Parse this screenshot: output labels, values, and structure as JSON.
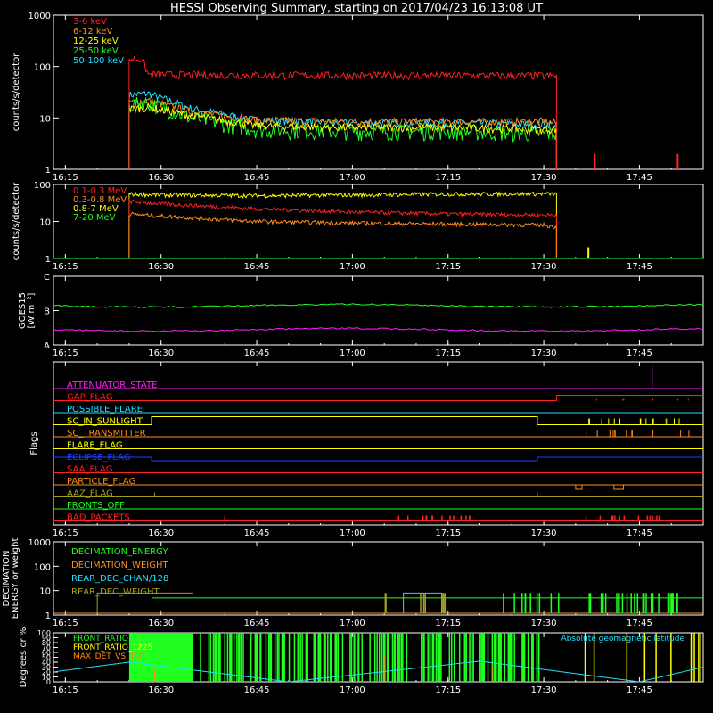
{
  "title": "HESSI Observing Summary, starting on 2017/04/23 16:13:08 UT",
  "time_axis": {
    "start": "16:13:08",
    "end": "17:55",
    "ticks": [
      "16:15",
      "16:30",
      "16:45",
      "17:00",
      "17:15",
      "17:30",
      "17:45"
    ]
  },
  "colors": {
    "red": "#ff2020",
    "orange": "#ff8c1a",
    "yellow": "#ffff00",
    "green": "#20ff20",
    "cyan": "#20e0ff",
    "magenta": "#ff20ff",
    "blue": "#2040ff",
    "olive": "#a0a020",
    "white": "#ffffff"
  },
  "chart_data": [
    {
      "type": "line",
      "ylabel": "counts/s/detector",
      "yscale": "log",
      "ylim": [
        1,
        1000
      ],
      "yticks": [
        "1",
        "10",
        "100",
        "1000"
      ],
      "legend_placement": "top-left",
      "series": [
        {
          "name": "3-6 keV",
          "color": "#ff2020",
          "x": [
            "16:25",
            "16:27",
            "16:28",
            "16:45",
            "17:00",
            "17:15",
            "17:30",
            "17:32"
          ],
          "values": [
            140,
            140,
            70,
            68,
            67,
            67,
            66,
            66
          ]
        },
        {
          "name": "6-12 keV",
          "color": "#ff8c1a",
          "x": [
            "16:25",
            "16:28",
            "16:35",
            "16:45",
            "17:00",
            "17:15",
            "17:30",
            "17:32"
          ],
          "values": [
            20,
            22,
            13,
            9,
            8.5,
            8.5,
            8.5,
            8
          ]
        },
        {
          "name": "12-25 keV",
          "color": "#ffff00",
          "x": [
            "16:25",
            "16:28",
            "16:35",
            "16:45",
            "17:00",
            "17:15",
            "17:30",
            "17:32"
          ],
          "values": [
            15,
            16,
            11,
            7,
            6.5,
            6.5,
            6,
            6
          ]
        },
        {
          "name": "25-50 keV",
          "color": "#20ff20",
          "x": [
            "16:25",
            "16:28",
            "16:35",
            "16:45",
            "17:00",
            "17:15",
            "17:30",
            "17:32"
          ],
          "values": [
            18,
            20,
            10,
            6,
            5.5,
            5.5,
            5,
            5
          ]
        },
        {
          "name": "50-100 keV",
          "color": "#20e0ff",
          "x": [
            "16:25",
            "16:28",
            "16:35",
            "16:45",
            "17:00",
            "17:15",
            "17:30",
            "17:32"
          ],
          "values": [
            28,
            30,
            15,
            9,
            8,
            8,
            7.5,
            7.5
          ]
        }
      ]
    },
    {
      "type": "line",
      "ylabel": "counts/s/detector",
      "yscale": "log",
      "ylim": [
        1,
        100
      ],
      "yticks": [
        "1",
        "10",
        "100"
      ],
      "legend_placement": "top-left",
      "series": [
        {
          "name": "0.1-0.3 MeV",
          "color": "#ff2020",
          "x": [
            "16:25",
            "16:30",
            "16:45",
            "17:00",
            "17:15",
            "17:30",
            "17:32"
          ],
          "values": [
            35,
            30,
            22,
            18,
            16,
            15,
            15
          ]
        },
        {
          "name": "0.3-0.8 MeV",
          "color": "#ff8c1a",
          "x": [
            "16:25",
            "16:30",
            "16:45",
            "17:00",
            "17:15",
            "17:30",
            "17:32"
          ],
          "values": [
            16,
            14,
            10,
            9,
            8.5,
            8,
            7
          ]
        },
        {
          "name": "0.8-7 MeV",
          "color": "#ffff00",
          "x": [
            "16:25",
            "16:30",
            "16:45",
            "17:00",
            "17:15",
            "17:30",
            "17:32"
          ],
          "values": [
            55,
            52,
            50,
            52,
            55,
            56,
            55
          ]
        },
        {
          "name": "7-20 MeV",
          "color": "#20ff20",
          "x": [
            "16:13",
            "17:55"
          ],
          "values": [
            1,
            1
          ]
        }
      ]
    },
    {
      "type": "line",
      "ylabel": "GOES15 [W m⁻²]",
      "ylabels": [
        "GOES15",
        "[W m⁻²]"
      ],
      "yticks": [
        "A",
        "B",
        "C"
      ],
      "series": [
        {
          "color": "#20ff20",
          "x": [
            "16:13",
            "17:55"
          ],
          "values": [
            "B+",
            "B+"
          ]
        },
        {
          "color": "#ff20ff",
          "x": [
            "16:13",
            "17:55"
          ],
          "values": [
            "A+",
            "A+"
          ]
        }
      ]
    },
    {
      "type": "line",
      "ylabel": "Flags",
      "flags": [
        {
          "name": "ATTENUATOR_STATE",
          "color": "#ff20ff"
        },
        {
          "name": "GAP_FLAG",
          "color": "#ff2020"
        },
        {
          "name": "POSSIBLE_FLARE",
          "color": "#20e0ff"
        },
        {
          "name": "SC_IN_SUNLIGHT",
          "color": "#ffff00"
        },
        {
          "name": "SC_TRANSMITTER",
          "color": "#ff8c1a"
        },
        {
          "name": "FLARE_FLAG",
          "color": "#ffff00"
        },
        {
          "name": "ECLIPSE_FLAG",
          "color": "#2040ff"
        },
        {
          "name": "SAA_FLAG",
          "color": "#ff2020"
        },
        {
          "name": "PARTICLE_FLAG",
          "color": "#ff8c1a"
        },
        {
          "name": "AAZ_FLAG",
          "color": "#a0a020"
        },
        {
          "name": "FRONTS_OFF",
          "color": "#20ff20"
        },
        {
          "name": "BAD_PACKETS",
          "color": "#ff2020"
        }
      ]
    },
    {
      "type": "line",
      "ylabel": "DECIMATION ENERGY or weight",
      "ylabels": [
        "DECIMATION",
        "ENERGY or weight"
      ],
      "yscale": "log",
      "ylim": [
        1,
        1000
      ],
      "yticks": [
        "1",
        "10",
        "100",
        "1000"
      ],
      "legend_placement": "top-left",
      "series": [
        {
          "name": "DECIMATION_ENERGY",
          "color": "#20ff20"
        },
        {
          "name": "DECIMATION_WEIGHT",
          "color": "#ff8c1a"
        },
        {
          "name": "REAR_DEC_CHAN/128",
          "color": "#20e0ff"
        },
        {
          "name": "REAR_DEC_WEIGHT",
          "color": "#a0a020"
        }
      ]
    },
    {
      "type": "line",
      "ylabel": "Degrees or %",
      "ylim": [
        0,
        100
      ],
      "yticks": [
        "0",
        "10",
        "20",
        "30",
        "40",
        "50",
        "60",
        "70",
        "80",
        "90",
        "100"
      ],
      "legend_placement": "top-left",
      "series": [
        {
          "name": "FRONT_RATIO",
          "color": "#20ff20"
        },
        {
          "name": "FRONT_RATIO_1225",
          "color": "#ffff00"
        },
        {
          "name": "MAX_DET_VS_TOT",
          "color": "#ff8c1a"
        },
        {
          "name": "Absolute geomagnetic latitude",
          "color": "#20e0ff",
          "x": [
            "16:13",
            "16:25",
            "16:50",
            "17:20",
            "17:45",
            "17:55"
          ],
          "values": [
            20,
            40,
            0,
            42,
            0,
            30
          ]
        }
      ]
    }
  ]
}
